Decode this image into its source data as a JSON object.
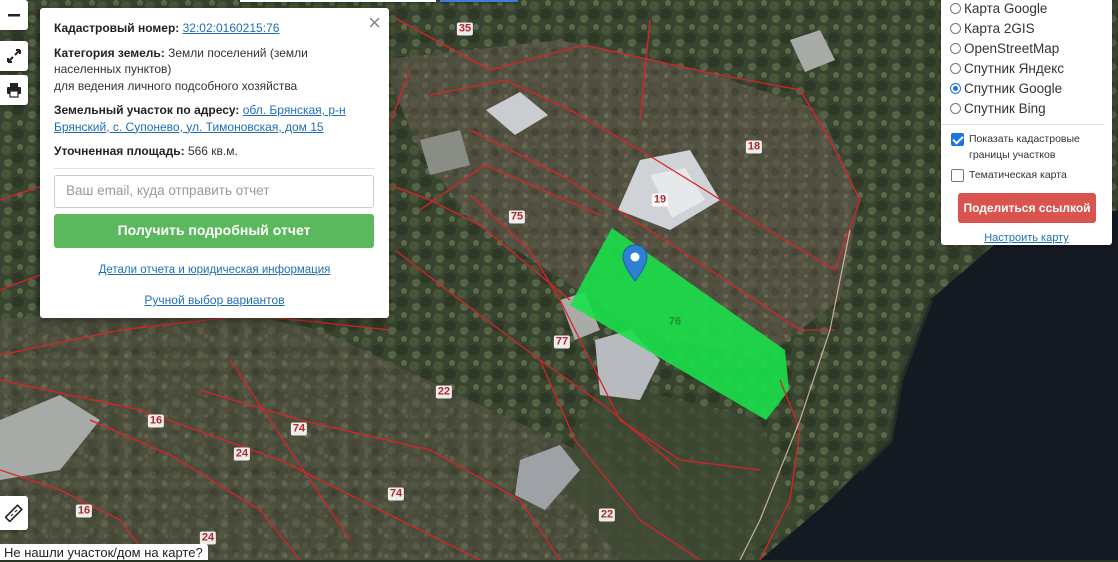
{
  "map": {
    "parcel_numbers": [
      "35",
      "18",
      "19",
      "75",
      "76",
      "77",
      "22",
      "16",
      "74",
      "24",
      "74",
      "16",
      "24",
      "22"
    ],
    "selected_parcel": "76",
    "colors": {
      "boundary": "#d8232a",
      "selected_fill": "#19e04a",
      "marker": "#2f7fd3"
    }
  },
  "controls": {
    "zoom_out_icon": "minus-icon",
    "fullscreen_icon": "expand-icon",
    "print_icon": "printer-icon",
    "ruler_icon": "ruler-icon"
  },
  "popup": {
    "cadastral_label": "Кадастровый номер:",
    "cadastral_value": "32:02:0160215:76",
    "category_label": "Категория земель:",
    "category_value": "Земли поселений (земли населенных пунктов)",
    "category_use": "для ведения личного подсобного хозяйства",
    "address_label": "Земельный участок по адресу:",
    "address_value": "обл. Брянская, р-н Брянский, с. Супонево, ул. Тимоновская, дом 15",
    "area_label": "Уточненная площадь:",
    "area_value": "566 кв.м.",
    "email_placeholder": "Ваш email, куда отправить отчет",
    "report_button": "Получить подробный отчет",
    "details_link": "Детали отчета и юридическая информация",
    "manual_link": "Ручной выбор вариантов"
  },
  "panel": {
    "map_options": [
      {
        "label": "Карта Google",
        "selected": false
      },
      {
        "label": "Карта 2GIS",
        "selected": false
      },
      {
        "label": "OpenStreetMap",
        "selected": false
      },
      {
        "label": "Спутник Яндекс",
        "selected": false
      },
      {
        "label": "Спутник Google",
        "selected": true
      },
      {
        "label": "Спутник Bing",
        "selected": false
      }
    ],
    "show_boundaries_label": "Показать кадастровые границы участков",
    "show_boundaries_checked": true,
    "thematic_label": "Тематическая карта",
    "thematic_checked": false,
    "share_button": "Поделиться ссылкой",
    "configure_link": "Настроить карту"
  },
  "footer": {
    "not_found": "Не нашли участок/дом на карте?"
  }
}
